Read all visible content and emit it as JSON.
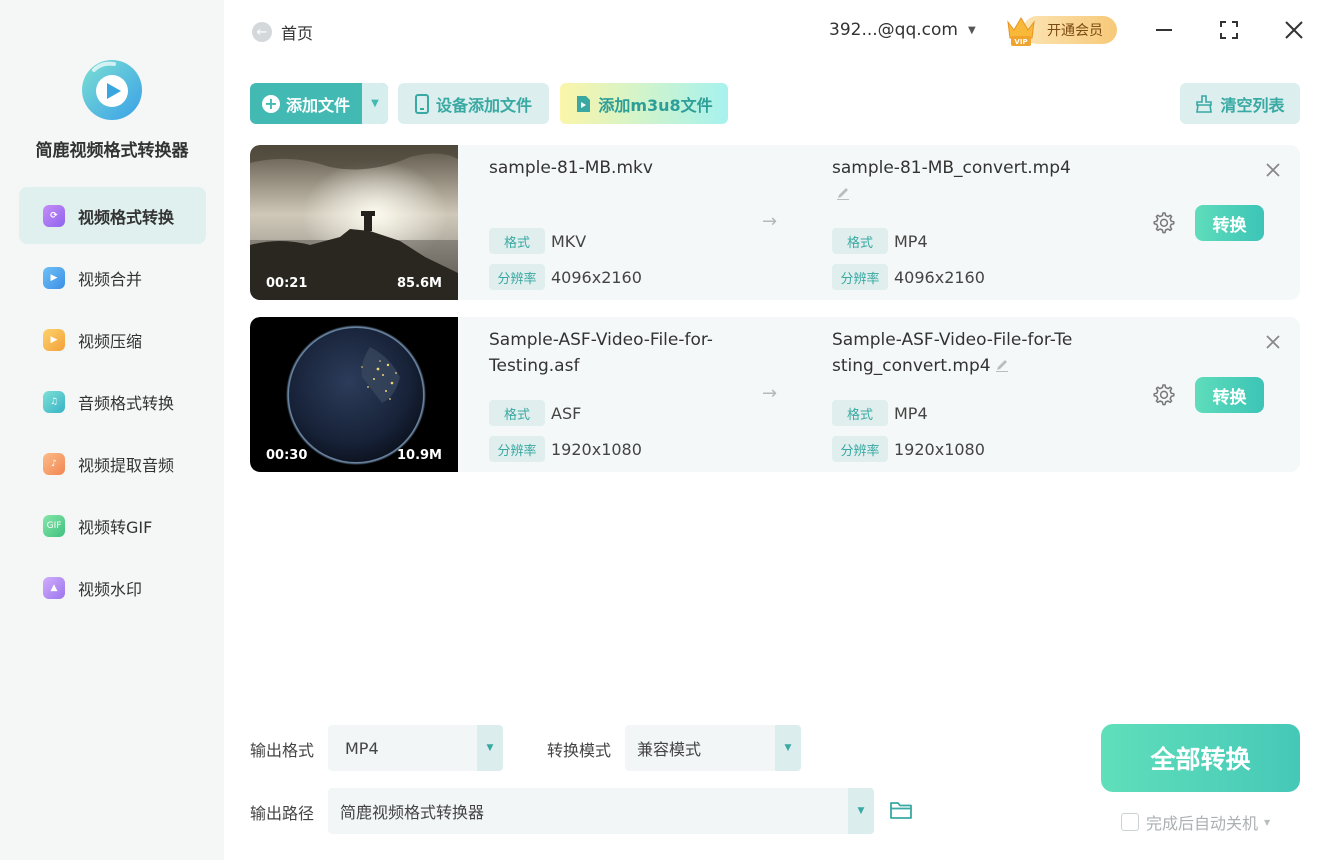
{
  "app": {
    "title": "简鹿视频格式转换器"
  },
  "sidebar": {
    "items": [
      {
        "label": "视频格式转换",
        "icon": "video-convert-icon",
        "color": "#a77cf2",
        "active": true
      },
      {
        "label": "视频合并",
        "icon": "video-merge-icon",
        "color": "#4aa3ee"
      },
      {
        "label": "视频压缩",
        "icon": "video-compress-icon",
        "color": "#f6b74a"
      },
      {
        "label": "音频格式转换",
        "icon": "audio-convert-icon",
        "color": "#49c6c0"
      },
      {
        "label": "视频提取音频",
        "icon": "extract-audio-icon",
        "color": "#f59a66"
      },
      {
        "label": "视频转GIF",
        "icon": "gif-icon",
        "color": "#58cf8f"
      },
      {
        "label": "视频水印",
        "icon": "watermark-icon",
        "color": "#b38bf0"
      }
    ]
  },
  "topbar": {
    "home_label": "首页",
    "account": "392...@qq.com",
    "vip_label": "开通会员"
  },
  "toolbar": {
    "add_file": "添加文件",
    "device_add": "设备添加文件",
    "add_m3u8": "添加m3u8文件",
    "clear_list": "清空列表"
  },
  "labels": {
    "format": "格式",
    "resolution": "分辨率",
    "convert": "转换"
  },
  "files": [
    {
      "duration": "00:21",
      "size": "85.6M",
      "source_name": "sample-81-MB.mkv",
      "source_format": "MKV",
      "source_resolution": "4096x2160",
      "output_name": "sample-81-MB_convert.mp4",
      "output_format": "MP4",
      "output_resolution": "4096x2160"
    },
    {
      "duration": "00:30",
      "size": "10.9M",
      "source_name": "Sample-ASF-Video-File-for-Testing.asf",
      "source_format": "ASF",
      "source_resolution": "1920x1080",
      "output_name": "Sample-ASF-Video-File-for-Testing_convert.mp4",
      "output_format": "MP4",
      "output_resolution": "1920x1080"
    }
  ],
  "bottom": {
    "output_format_label": "输出格式",
    "output_format_value": "MP4",
    "convert_mode_label": "转换模式",
    "convert_mode_value": "兼容模式",
    "output_path_label": "输出路径",
    "output_path_value": "简鹿视频格式转换器",
    "convert_all": "全部转换",
    "auto_shutdown": "完成后自动关机"
  },
  "colors": {
    "accent": "#43b9b3",
    "accent_light": "#dceeed",
    "sidebar_bg": "#f5f7f7",
    "card_bg": "#f5f8f8"
  }
}
